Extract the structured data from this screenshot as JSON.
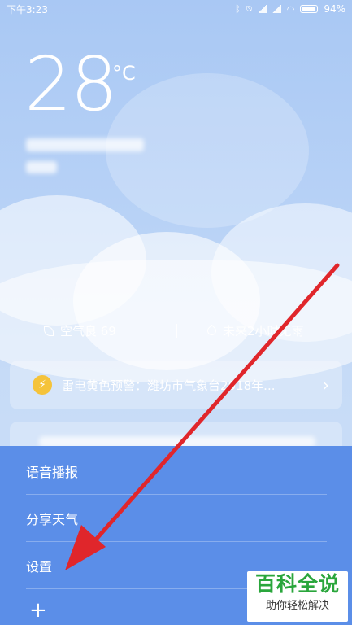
{
  "status_bar": {
    "time": "下午3:23",
    "icons": [
      "bluetooth-icon",
      "mute-icon",
      "signal-icon",
      "signal-icon",
      "wifi-icon",
      "battery-icon"
    ],
    "battery": "94%"
  },
  "weather": {
    "temperature": "28",
    "unit": "°C",
    "air_quality": "空气良 69",
    "rain_forecast": "未来2小时无雨"
  },
  "alert": {
    "text": "雷电黄色预警：潍坊市气象台2018年..."
  },
  "menu": {
    "items": [
      {
        "label": "语音播报"
      },
      {
        "label": "分享天气"
      },
      {
        "label": "设置"
      }
    ],
    "add_label": "+"
  },
  "watermark": {
    "main": "百科全说",
    "sub": "助你轻松解决"
  },
  "colors": {
    "sheet": "#5b8ee8",
    "alert_icon": "#f5c33a",
    "arrow": "#e0262b",
    "watermark_text": "#2aa63c"
  }
}
